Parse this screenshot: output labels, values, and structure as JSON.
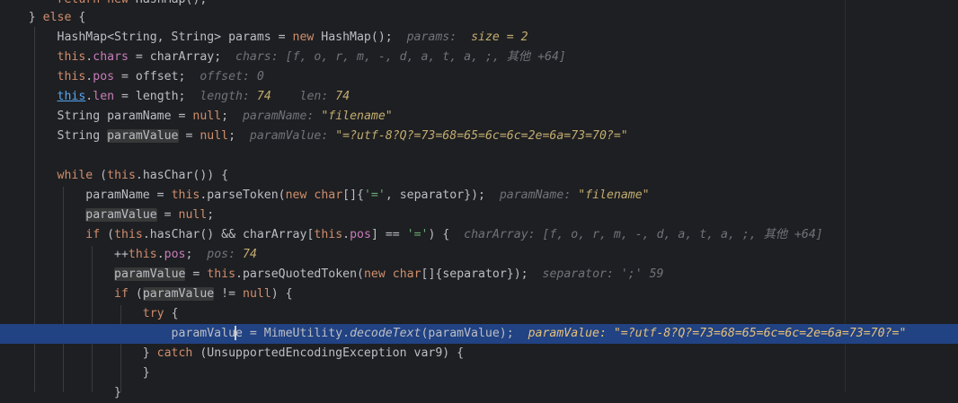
{
  "editor": {
    "lines": [
      {
        "top_text": "        return new HashMap();"
      },
      {
        "text": "    } else {"
      },
      {
        "text": "        HashMap<String, String> params = new HashMap();",
        "hint_label": "params:",
        "hint_value": "size = 2"
      },
      {
        "text_pre": ".chars = charArray;",
        "hint_label": "chars:",
        "hint_value": "[f, o, r, m, -, d, a, t, a, ;, 其他 +64]"
      },
      {
        "text_pre": ".pos = offset;",
        "hint_label": "offset:",
        "hint_value": "0"
      },
      {
        "text_pre": ".len = length;",
        "hint_label": "length:",
        "hint_value": "74",
        "hint2_label": "len:",
        "hint2_value": "74"
      },
      {
        "text": "        String paramName = null;",
        "hint_label": "paramName:",
        "hint_value": "\"filename\""
      },
      {
        "text_pre": "        String ",
        "var": "paramValue",
        "text_post": " = null;",
        "hint_label": "paramValue:",
        "hint_value": "\"=?utf-8?Q?=73=68=65=6c=6c=2e=6a=73=70?=\""
      },
      {
        "text": ""
      },
      {
        "text": "        while (this.hasChar()) {"
      },
      {
        "text": "            paramName = this.parseToken(new char[]{'=', separator});",
        "hint_label": "paramName:",
        "hint_value": "\"filename\""
      },
      {
        "text": "            paramValue = null;"
      },
      {
        "text": "            if (this.hasChar() && charArray[this.pos] == '=') {",
        "hint_label": "charArray:",
        "hint_value": "[f, o, r, m, -, d, a, t, a, ;, 其他 +64]"
      },
      {
        "text": "                ++this.pos;",
        "hint_label": "pos:",
        "hint_value": "74"
      },
      {
        "text": "                paramValue = this.parseQuotedToken(new char[]{separator});",
        "hint_label": "separator:",
        "hint_value": "';' 59"
      },
      {
        "text": "                if (paramValue != null) {"
      },
      {
        "text": "                    try {"
      },
      {
        "text": "                        paramValue = MimeUtility.decodeText(paramValue);",
        "hint_label": "paramValue:",
        "hint_value": "\"=?utf-8?Q?=73=68=65=6c=6c=2e=6a=73=70?=\""
      },
      {
        "text": "                    } catch (UnsupportedEncodingException var9) {"
      },
      {
        "text": "                    }"
      },
      {
        "text": "                }"
      }
    ],
    "keywords": {
      "return": "return",
      "new": "new",
      "else": "else",
      "this": "this",
      "null": "null",
      "while": "while",
      "if": "if",
      "try": "try",
      "catch": "catch",
      "char": "char"
    },
    "colors": {
      "background": "#1e1f22",
      "keyword": "#cf8e6d",
      "field": "#c77dbb",
      "string": "#6aab73",
      "current_line": "#214283",
      "hint": "#6f737a"
    }
  }
}
